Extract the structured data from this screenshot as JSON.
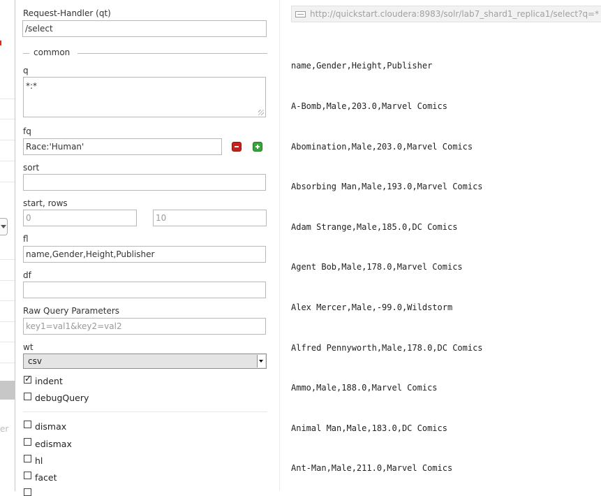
{
  "nav": {
    "cut_text": "er"
  },
  "form": {
    "request_handler": {
      "label": "Request-Handler (qt)",
      "value": "/select"
    },
    "common_legend": "common",
    "q": {
      "label": "q",
      "value": "*:*"
    },
    "fq": {
      "label": "fq",
      "value": "Race:'Human'"
    },
    "sort": {
      "label": "sort",
      "value": ""
    },
    "start_rows": {
      "label": "start, rows",
      "start_placeholder": "0",
      "rows_placeholder": "10"
    },
    "fl": {
      "label": "fl",
      "value": "name,Gender,Height,Publisher"
    },
    "df": {
      "label": "df",
      "value": ""
    },
    "raw": {
      "label": "Raw Query Parameters",
      "placeholder": "key1=val1&key2=val2"
    },
    "wt": {
      "label": "wt",
      "value": "csv"
    },
    "indent": {
      "label": "indent",
      "checked": true
    },
    "debugQuery": {
      "label": "debugQuery",
      "checked": false
    },
    "dismax": {
      "label": "dismax",
      "checked": false
    },
    "edismax": {
      "label": "edismax",
      "checked": false
    },
    "hl": {
      "label": "hl",
      "checked": false
    },
    "facet": {
      "label": "facet",
      "checked": false
    }
  },
  "results": {
    "url": "http://quickstart.cloudera:8983/solr/lab7_shard1_replica1/select?q=*",
    "lines": [
      "name,Gender,Height,Publisher",
      "A-Bomb,Male,203.0,Marvel Comics",
      "Abomination,Male,203.0,Marvel Comics",
      "Absorbing Man,Male,193.0,Marvel Comics",
      "Adam Strange,Male,185.0,DC Comics",
      "Agent Bob,Male,178.0,Marvel Comics",
      "Alex Mercer,Male,-99.0,Wildstorm",
      "Alfred Pennyworth,Male,178.0,DC Comics",
      "Ammo,Male,188.0,Marvel Comics",
      "Animal Man,Male,183.0,DC Comics",
      "Ant-Man,Male,211.0,Marvel Comics"
    ]
  },
  "colors": {
    "remove": "#c8201c",
    "add": "#3aa53a",
    "active_nav": "#c7c7c7"
  }
}
